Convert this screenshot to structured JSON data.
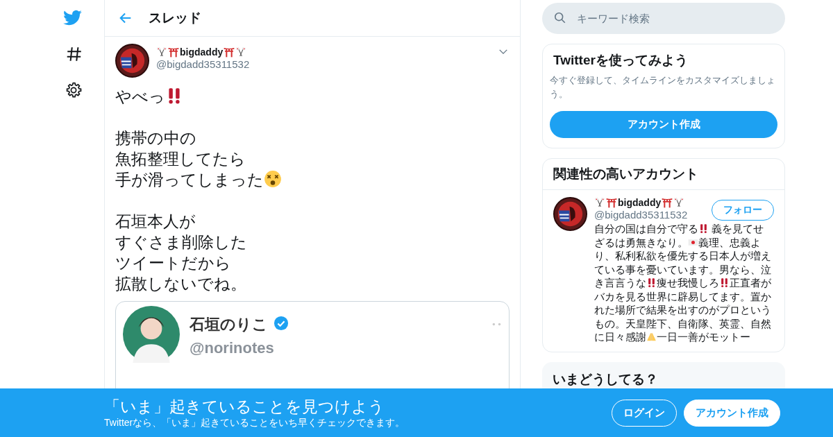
{
  "nav": {
    "items": [
      {
        "kind": "bird"
      },
      {
        "kind": "hash"
      },
      {
        "kind": "gear"
      }
    ]
  },
  "header": {
    "title": "スレッド"
  },
  "tweet": {
    "author": {
      "name": [
        {
          "kind": "flags"
        },
        {
          "kind": "torii"
        },
        {
          "kind": "text",
          "text": "bigdaddy"
        },
        {
          "kind": "torii"
        },
        {
          "kind": "flags"
        }
      ],
      "handle": "@bigdadd35311532"
    },
    "paragraphs": [
      [
        [
          {
            "kind": "text",
            "text": "やべっ"
          },
          {
            "kind": "bangbang"
          }
        ]
      ],
      [
        [
          {
            "kind": "text",
            "text": "携帯の中の"
          }
        ],
        [
          {
            "kind": "text",
            "text": "魚拓整理してたら"
          }
        ],
        [
          {
            "kind": "text",
            "text": "手が滑ってしまった"
          },
          {
            "kind": "dizzy"
          }
        ]
      ],
      [
        [
          {
            "kind": "text",
            "text": "石垣本人が"
          }
        ],
        [
          {
            "kind": "text",
            "text": "すぐさま削除した"
          }
        ],
        [
          {
            "kind": "text",
            "text": "ツイートだから"
          }
        ],
        [
          {
            "kind": "text",
            "text": "拡散しないでね。"
          }
        ]
      ]
    ],
    "embedded": {
      "name": "石垣のりこ",
      "verified": true,
      "handle": "@norinotes"
    }
  },
  "search": {
    "placeholder": "キーワード検索"
  },
  "signup_card": {
    "title": "Twitterを使ってみよう",
    "text": "今すぐ登録して、タイムラインをカスタマイズしましょう。",
    "button": "アカウント作成"
  },
  "related": {
    "title": "関連性の高いアカウント",
    "accounts": [
      {
        "name": [
          {
            "kind": "flags"
          },
          {
            "kind": "torii"
          },
          {
            "kind": "text",
            "text": "bigdaddy"
          },
          {
            "kind": "torii"
          },
          {
            "kind": "flags"
          }
        ],
        "handle": "@bigdadd35311532",
        "follow": "フォロー",
        "bio": [
          {
            "kind": "text",
            "text": "自分の国は自分で守る"
          },
          {
            "kind": "bangbang"
          },
          {
            "kind": "text",
            "text": " 義を見てせざるは勇無きなり。"
          },
          {
            "kind": "jpflag"
          },
          {
            "kind": "text",
            "text": "義理、忠義より、私利私欲を優先する日本人が増えている事を憂いています。男なら、泣き言言うな"
          },
          {
            "kind": "bangbang"
          },
          {
            "kind": "text",
            "text": "痩せ我慢しろ"
          },
          {
            "kind": "bangbang"
          },
          {
            "kind": "text",
            "text": "正直者がバカを見る世界に辟易してます。置かれた場所で結果を出すのがプロというもの。天皇陛下、自衛隊、英霊、自然に日々感謝"
          },
          {
            "kind": "pray"
          },
          {
            "kind": "text",
            "text": "一日一善がモットー"
          }
        ]
      }
    ]
  },
  "trends": {
    "title": "いまどうしてる？"
  },
  "bottom_bar": {
    "title": "「いま」起きていることを見つけよう",
    "subtitle": "Twitterなら、「いま」起きていることをいち早くチェックできます。",
    "buttons": [
      {
        "label": "ログイン",
        "kind": "outline"
      },
      {
        "label": "アカウント作成",
        "kind": "solid"
      }
    ]
  }
}
